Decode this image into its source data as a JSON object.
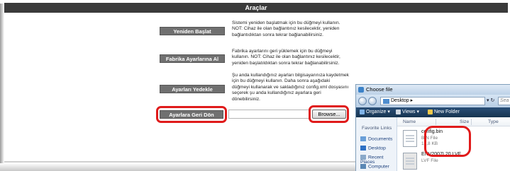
{
  "header": {
    "title": "Araçlar"
  },
  "rows": [
    {
      "button": "Yeniden Başlat",
      "desc": [
        "Sistemi yeniden başlatmak için bu düğmeyi kullanın.",
        "NOT: Cihaz ile olan bağlantınız kesilecektir, yeniden",
        "bağlantıdıktan sonra tekrar bağlanabilirsiniz."
      ]
    },
    {
      "button": "Fabrika Ayarlarına Al",
      "desc": [
        "Fabrika ayarlarını geri yüklemek için bu düğmeyi",
        "kullanın. NOT: Cihaz ile olan bağlantınız kesilecektir,",
        "yeniden başlatıldıktan sonra tekrar bağlanabilirsiniz."
      ]
    },
    {
      "button": "Ayarları Yedekle",
      "desc": [
        "Şu anda kullandığınız ayarları bilgisayarınıza kaydetmek",
        "için bu düğmeyi kullanın. Daha sonra aşağıdaki",
        "düğmeyi kullanarak ve sakladığınız config.xml dosyasını",
        "seçerek şu anda kullandığınız ayarlara geri",
        "dönebilirsiniz."
      ]
    },
    {
      "button": "Ayarlara Geri Dön"
    }
  ],
  "upload": {
    "browse_label": "Browse...",
    "file_value": ""
  },
  "dialog": {
    "title": "Choose file",
    "address": "Desktop",
    "address_arrow": "▸",
    "search_placeholder": "Sea",
    "toolbar": {
      "organize": "Organize ▾",
      "views": "Views ▾",
      "new_folder": "New Folder"
    },
    "sidebar": {
      "title": "Favorite Links",
      "items": [
        "Documents",
        "Desktop",
        "Recent Places",
        "Computer"
      ]
    },
    "columns": [
      "Name",
      "Size",
      "Type"
    ],
    "files": [
      {
        "name": "config.bin",
        "type": "BIN File",
        "size": "17,8 KB"
      },
      {
        "name": "ENV2007L20.LVF",
        "type": "LVF File",
        "size": ""
      }
    ]
  },
  "colors": {
    "highlight": "#e01b1b",
    "header": "#3a3a3a",
    "button": "#707070"
  }
}
